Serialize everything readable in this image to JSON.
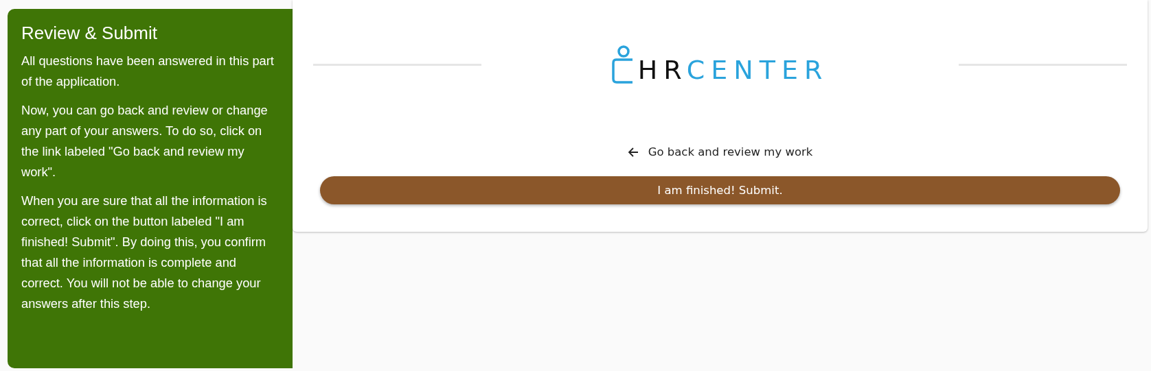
{
  "sidebar": {
    "title": "Review & Submit",
    "paragraphs": [
      "All questions have been answered in this part of the application.",
      "Now, you can go back and review or change any part of your answers. To do so, click on the link labeled \"Go back and review my work\".",
      "When you are sure that all the information is correct, click on the button labeled \"I am finished! Submit\". By doing this, you confirm that all the information is complete and correct. You will not be able to change your answers after this step."
    ]
  },
  "logo": {
    "parts": [
      {
        "text": "HR",
        "color": "#111111"
      },
      {
        "text": "CENTER",
        "color": "#2aa3dc"
      }
    ]
  },
  "back_link": {
    "label": "Go back and review my work"
  },
  "submit_button": {
    "label": "I am finished! Submit."
  }
}
